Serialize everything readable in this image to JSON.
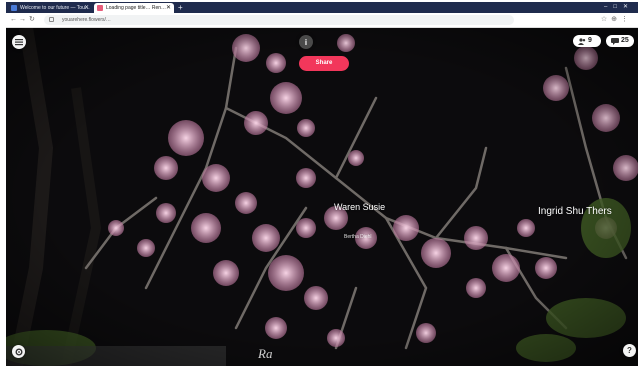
{
  "browser": {
    "tabs": [
      {
        "title": "Welcome to our future — Tou…",
        "active": false
      },
      {
        "title": "Loading page title… Ren…",
        "active": true
      }
    ],
    "url": "youarehere.flowers/…"
  },
  "hud": {
    "user_count": "9",
    "message_count": "25",
    "share_label": "Share"
  },
  "scene": {
    "names": [
      "Waren Susie",
      "Ingrid Shu Thers",
      "Bertha Diehl",
      "Ra"
    ],
    "colors": {
      "accent": "#f2375b",
      "background": "#0c0b0d",
      "blossom": "#e7b6d0"
    }
  }
}
